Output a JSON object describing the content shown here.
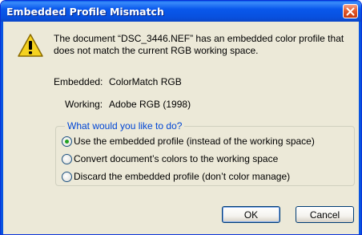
{
  "dialog": {
    "title": "Embedded Profile Mismatch",
    "message": "The document “DSC_3446.NEF” has an embedded color profile that does not match the current RGB working space.",
    "embedded_label": "Embedded:",
    "embedded_value": "ColorMatch RGB",
    "working_label": "Working:",
    "working_value": "Adobe RGB (1998)",
    "group_title": "What would you like to do?",
    "options": [
      {
        "label": "Use the embedded profile (instead of the working space)",
        "checked": true
      },
      {
        "label": "Convert document’s colors to the working space",
        "checked": false
      },
      {
        "label": "Discard the embedded profile (don’t color manage)",
        "checked": false
      }
    ],
    "ok_label": "OK",
    "cancel_label": "Cancel"
  },
  "icons": {
    "warning": "warning-icon",
    "close": "close-icon"
  },
  "colors": {
    "titlebar": "#0958ec",
    "dialog_bg": "#ece9d8",
    "close_button": "#e35b2c",
    "group_title": "#0046d5",
    "warning_fill": "#f5d21f"
  }
}
